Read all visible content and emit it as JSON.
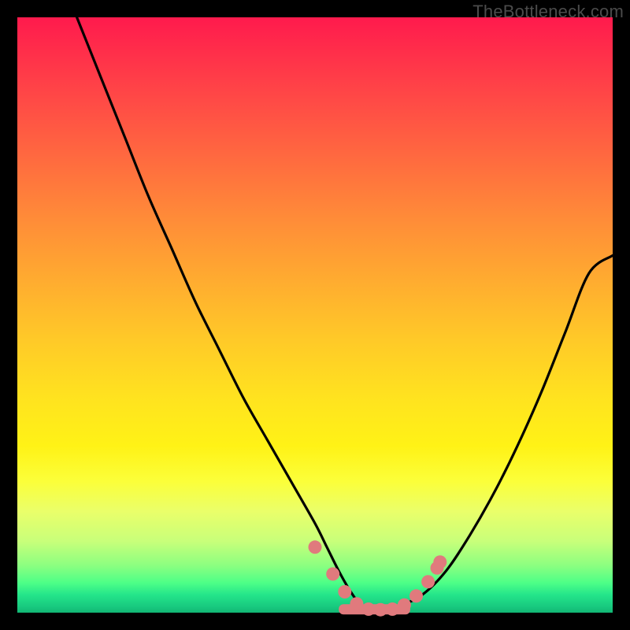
{
  "watermark": "TheBottleneck.com",
  "chart_data": {
    "type": "line",
    "title": "",
    "xlabel": "",
    "ylabel": "",
    "xlim": [
      0,
      100
    ],
    "ylim": [
      0,
      100
    ],
    "grid": false,
    "legend": false,
    "series": [
      {
        "name": "bottleneck-curve",
        "x": [
          10,
          14,
          18,
          22,
          26,
          30,
          34,
          38,
          42,
          46,
          50,
          52,
          54,
          56,
          58,
          60,
          62,
          64,
          68,
          72,
          76,
          80,
          84,
          88,
          92,
          96,
          100
        ],
        "y": [
          100,
          90,
          80,
          70,
          61,
          52,
          44,
          36,
          29,
          22,
          15,
          11,
          7,
          3.5,
          1,
          0.5,
          0.5,
          1,
          3,
          7,
          13,
          20,
          28,
          37,
          47,
          57,
          60
        ]
      }
    ],
    "markers": {
      "name": "optimal-points",
      "x": [
        50,
        53,
        55,
        57,
        59,
        61,
        63,
        65,
        67,
        69,
        70.5,
        71
      ],
      "y": [
        11,
        6.5,
        3.5,
        1.5,
        0.6,
        0.5,
        0.6,
        1.3,
        2.8,
        5.2,
        7.5,
        8.5
      ]
    },
    "flat_segment": {
      "x_start": 54,
      "x_end": 66,
      "y": 0.5
    },
    "gradient_stops": [
      {
        "pct": 0,
        "color": "#ff1a4d"
      },
      {
        "pct": 50,
        "color": "#ffc928"
      },
      {
        "pct": 80,
        "color": "#fbff3a"
      },
      {
        "pct": 100,
        "color": "#12b674"
      }
    ]
  }
}
